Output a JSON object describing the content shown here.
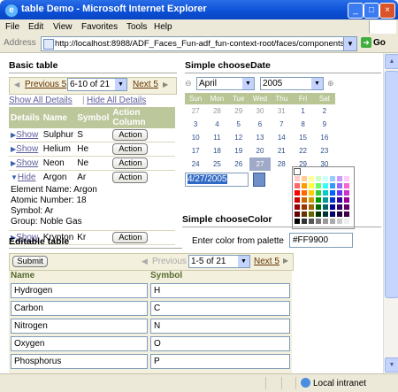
{
  "window": {
    "title": "table Demo - Microsoft Internet Explorer",
    "min": "_",
    "max": "□",
    "close": "×"
  },
  "menu": [
    "File",
    "Edit",
    "View",
    "Favorites",
    "Tools",
    "Help"
  ],
  "address": {
    "label": "Address",
    "url": "http://localhost:8988/ADF_Faces_Fun-adf_fun-context-root/faces/components/table.jspx",
    "go": "Go"
  },
  "basic_table": {
    "title": "Basic table",
    "prev": "Previous 5",
    "range": "6-10 of 21",
    "next": "Next 5",
    "show_all": "Show All Details",
    "hide_all": "Hide All Details",
    "columns": [
      "Details",
      "Name",
      "Symbol",
      "Action Column"
    ],
    "rows": [
      {
        "detail": "Show",
        "name": "Sulphur",
        "symbol": "S",
        "action": "Action"
      },
      {
        "detail": "Show",
        "name": "Helium",
        "symbol": "He",
        "action": "Action"
      },
      {
        "detail": "Show",
        "name": "Neon",
        "symbol": "Ne",
        "action": "Action"
      },
      {
        "detail": "Hide",
        "name": "Argon",
        "symbol": "Ar",
        "action": "Action"
      },
      {
        "detail": "Show",
        "name": "Krypton",
        "symbol": "Kr",
        "action": "Action"
      }
    ],
    "details": [
      "Element Name: Argon",
      "Atomic Number: 18",
      "Symbol: Ar",
      "Group: Noble Gas"
    ]
  },
  "choose_date": {
    "title": "Simple chooseDate",
    "month": "April",
    "year": "2005",
    "weekdays": [
      "Sun",
      "Mon",
      "Tue",
      "Wed",
      "Thu",
      "Fri",
      "Sat"
    ],
    "weeks": [
      [
        "27",
        "28",
        "29",
        "30",
        "31",
        "1",
        "2"
      ],
      [
        "3",
        "4",
        "5",
        "6",
        "7",
        "8",
        "9"
      ],
      [
        "10",
        "11",
        "12",
        "13",
        "14",
        "15",
        "16"
      ],
      [
        "17",
        "18",
        "19",
        "20",
        "21",
        "22",
        "23"
      ],
      [
        "24",
        "25",
        "26",
        "27",
        "28",
        "29",
        "30"
      ]
    ],
    "value": "4/27/2005"
  },
  "choose_color": {
    "title": "Simple  chooseColor",
    "label": "Enter color from palette",
    "value": "#FF9900",
    "palette": [
      "#ffffff",
      "#ffffff",
      "#ffffff",
      "#ffffff",
      "#ffffff",
      "#ffffff",
      "#ffffff",
      "#ffffff",
      "#ffcccc",
      "#ffcc99",
      "#ffff99",
      "#ccffcc",
      "#ccffff",
      "#99ccff",
      "#cc99ff",
      "#ffccff",
      "#ff6666",
      "#ff9900",
      "#ffff33",
      "#66ff66",
      "#33ffff",
      "#3399ff",
      "#9966ff",
      "#ff66cc",
      "#ff0000",
      "#ff6600",
      "#ffcc00",
      "#33cc33",
      "#00cccc",
      "#0066ff",
      "#6633ff",
      "#cc33cc",
      "#cc0000",
      "#cc6600",
      "#cc9900",
      "#009900",
      "#009999",
      "#0033cc",
      "#330099",
      "#990099",
      "#990000",
      "#993300",
      "#996600",
      "#006600",
      "#006666",
      "#000099",
      "#330066",
      "#660066",
      "#660000",
      "#663300",
      "#666600",
      "#003300",
      "#003333",
      "#000066",
      "#220044",
      "#440044",
      "#000000",
      "#333333",
      "#555555",
      "#777777",
      "#999999",
      "#aaaaaa",
      "#cccccc",
      "#eeeeee"
    ]
  },
  "editable_table": {
    "title": "Editable table",
    "submit": "Submit",
    "prev": "Previous",
    "range": "1-5 of 21",
    "next": "Next 5",
    "columns": [
      "Name",
      "Symbol"
    ],
    "rows": [
      {
        "name": "Hydrogen",
        "symbol": "H"
      },
      {
        "name": "Carbon",
        "symbol": "C"
      },
      {
        "name": "Nitrogen",
        "symbol": "N"
      },
      {
        "name": "Oxygen",
        "symbol": "O"
      },
      {
        "name": "Phosphorus",
        "symbol": "P"
      }
    ]
  },
  "status": {
    "zone": "Local intranet"
  }
}
